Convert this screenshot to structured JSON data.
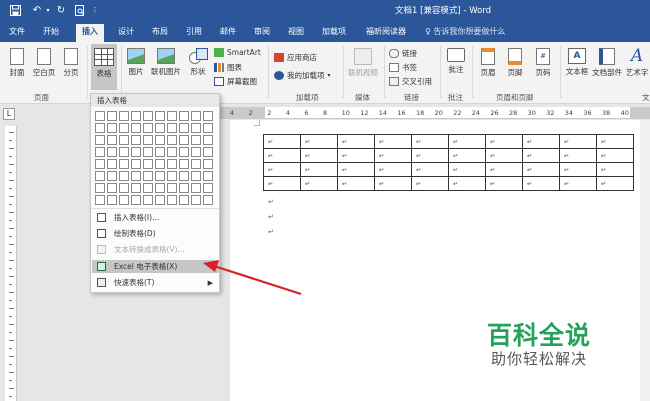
{
  "window": {
    "title": "文档1 [兼容模式] - Word",
    "quick_access": [
      "save-icon",
      "undo-icon",
      "redo-icon",
      "print-preview-icon",
      "customize-icon"
    ]
  },
  "tabs": [
    {
      "label": "文件"
    },
    {
      "label": "开始"
    },
    {
      "label": "插入",
      "active": true
    },
    {
      "label": "设计"
    },
    {
      "label": "布局"
    },
    {
      "label": "引用"
    },
    {
      "label": "邮件"
    },
    {
      "label": "审阅"
    },
    {
      "label": "视图"
    },
    {
      "label": "加载项"
    },
    {
      "label": "福昕阅读器"
    }
  ],
  "tell_me": "告诉我你想要做什么",
  "ribbon": {
    "cover": "封面",
    "blank_page": "空白页",
    "page_break": "分页",
    "table": "表格",
    "picture": "图片",
    "online_picture": "联机图片",
    "shapes": "形状",
    "smartart": "SmartArt",
    "chart": "图表",
    "screenshot": "屏幕截图",
    "app_store": "应用商店",
    "my_addins": "我的加载项",
    "online_video": "联机视频",
    "link": "链接",
    "bookmark": "书签",
    "cross_ref": "交叉引用",
    "comment": "批注",
    "header": "页眉",
    "footer": "页脚",
    "page_num": "页码",
    "textbox": "文本框",
    "quick_parts": "文档部件",
    "wordart": "艺术字",
    "groups": {
      "pages": "页面",
      "addins": "加载项",
      "media": "媒体",
      "links": "链接",
      "comments": "批注",
      "header_footer": "页眉和页脚",
      "text": "文"
    }
  },
  "ruler": {
    "h_numbers": [
      "4",
      "2",
      "2",
      "4",
      "6",
      "8",
      "10",
      "12",
      "14",
      "16",
      "18",
      "20",
      "22",
      "24",
      "26",
      "28",
      "30",
      "32",
      "34",
      "36",
      "38",
      "40"
    ]
  },
  "dropdown": {
    "header": "插入表格",
    "grid_cols": 10,
    "grid_rows": 8,
    "items": [
      {
        "label": "插入表格(I)...",
        "disabled": false
      },
      {
        "label": "绘制表格(D)",
        "disabled": false
      },
      {
        "label": "文本转换成表格(V)...",
        "disabled": true
      },
      {
        "label": "Excel 电子表格(X)",
        "disabled": false,
        "highlighted": true
      },
      {
        "label": "快速表格(T)",
        "disabled": false,
        "submenu": true
      }
    ]
  },
  "document": {
    "table_rows": 4,
    "table_cols": 10,
    "paragraph_mark": "↵"
  },
  "watermark": {
    "title": "百科全说",
    "subtitle": "助你轻松解决"
  },
  "colors": {
    "word_blue": "#2b579a",
    "arrow_red": "#d9202a",
    "watermark_green": "#23a35a"
  }
}
